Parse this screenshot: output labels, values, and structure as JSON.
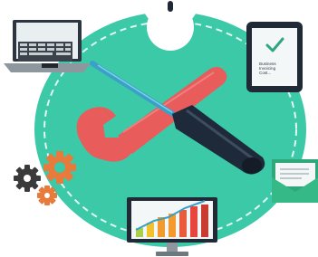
{
  "illustration": {
    "subject": "tools-and-devices",
    "icons": [
      "wrench-icon",
      "screwdriver-icon",
      "laptop-icon",
      "tablet-icon",
      "gears-icon",
      "envelope-icon",
      "bar-chart-monitor-icon",
      "mouse-icon"
    ],
    "tablet_text": [
      "Business",
      "Invoicing",
      "Cost..."
    ],
    "colors": {
      "circle": "#3cc9a8",
      "wrench": "#e85c5c",
      "screwdriver_handle": "#1e2a3a",
      "screwdriver_shaft": "#3aa0c8",
      "gear_dark": "#3a3a3a",
      "gear_orange": "#e87a3c",
      "envelope": "#2ea87a",
      "chart_bars": [
        "#f2c12e",
        "#f29a2e",
        "#e85c3c",
        "#e8453c"
      ]
    }
  }
}
